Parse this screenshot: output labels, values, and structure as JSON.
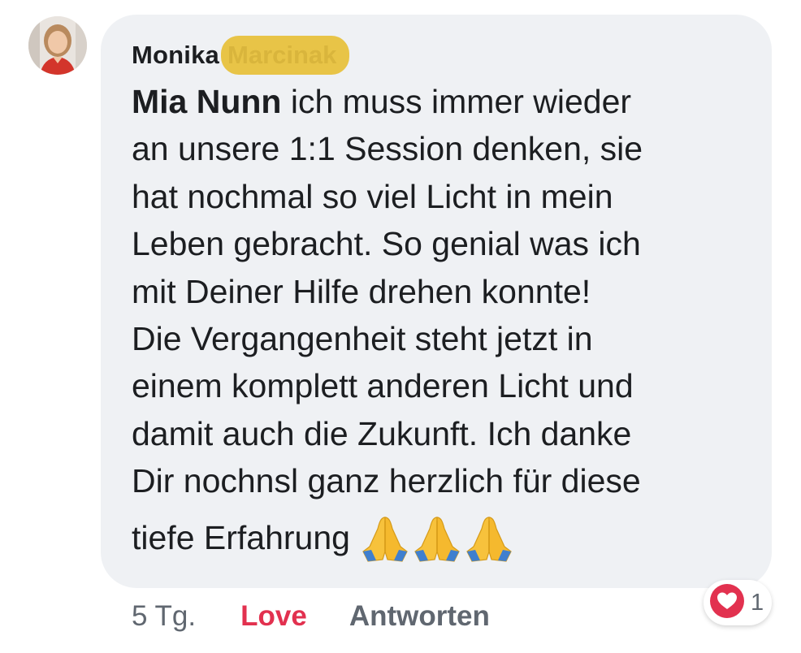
{
  "author": {
    "first_name": "Monika",
    "surname_redacted": "Marcinak"
  },
  "comment": {
    "mention": "Mia Nunn",
    "body_lines": [
      " ich muss immer wieder",
      "an unsere 1:1 Session denken, sie",
      "hat nochmal so viel Licht in mein",
      "Leben gebracht. So genial was ich",
      "mit Deiner Hilfe drehen konnte!",
      "Die Vergangenheit steht jetzt in",
      "einem komplett anderen Licht und",
      "damit auch die Zukunft. Ich danke",
      "Dir nochnsl ganz herzlich für diese"
    ],
    "last_line": "tiefe Erfahrung",
    "emojis": [
      "folded-hands",
      "folded-hands",
      "folded-hands"
    ]
  },
  "footer": {
    "time": "5 Tg.",
    "love_label": "Love",
    "reply_label": "Antworten"
  },
  "reaction": {
    "icon": "heart-icon",
    "color": "#e2314f",
    "count": "1"
  }
}
